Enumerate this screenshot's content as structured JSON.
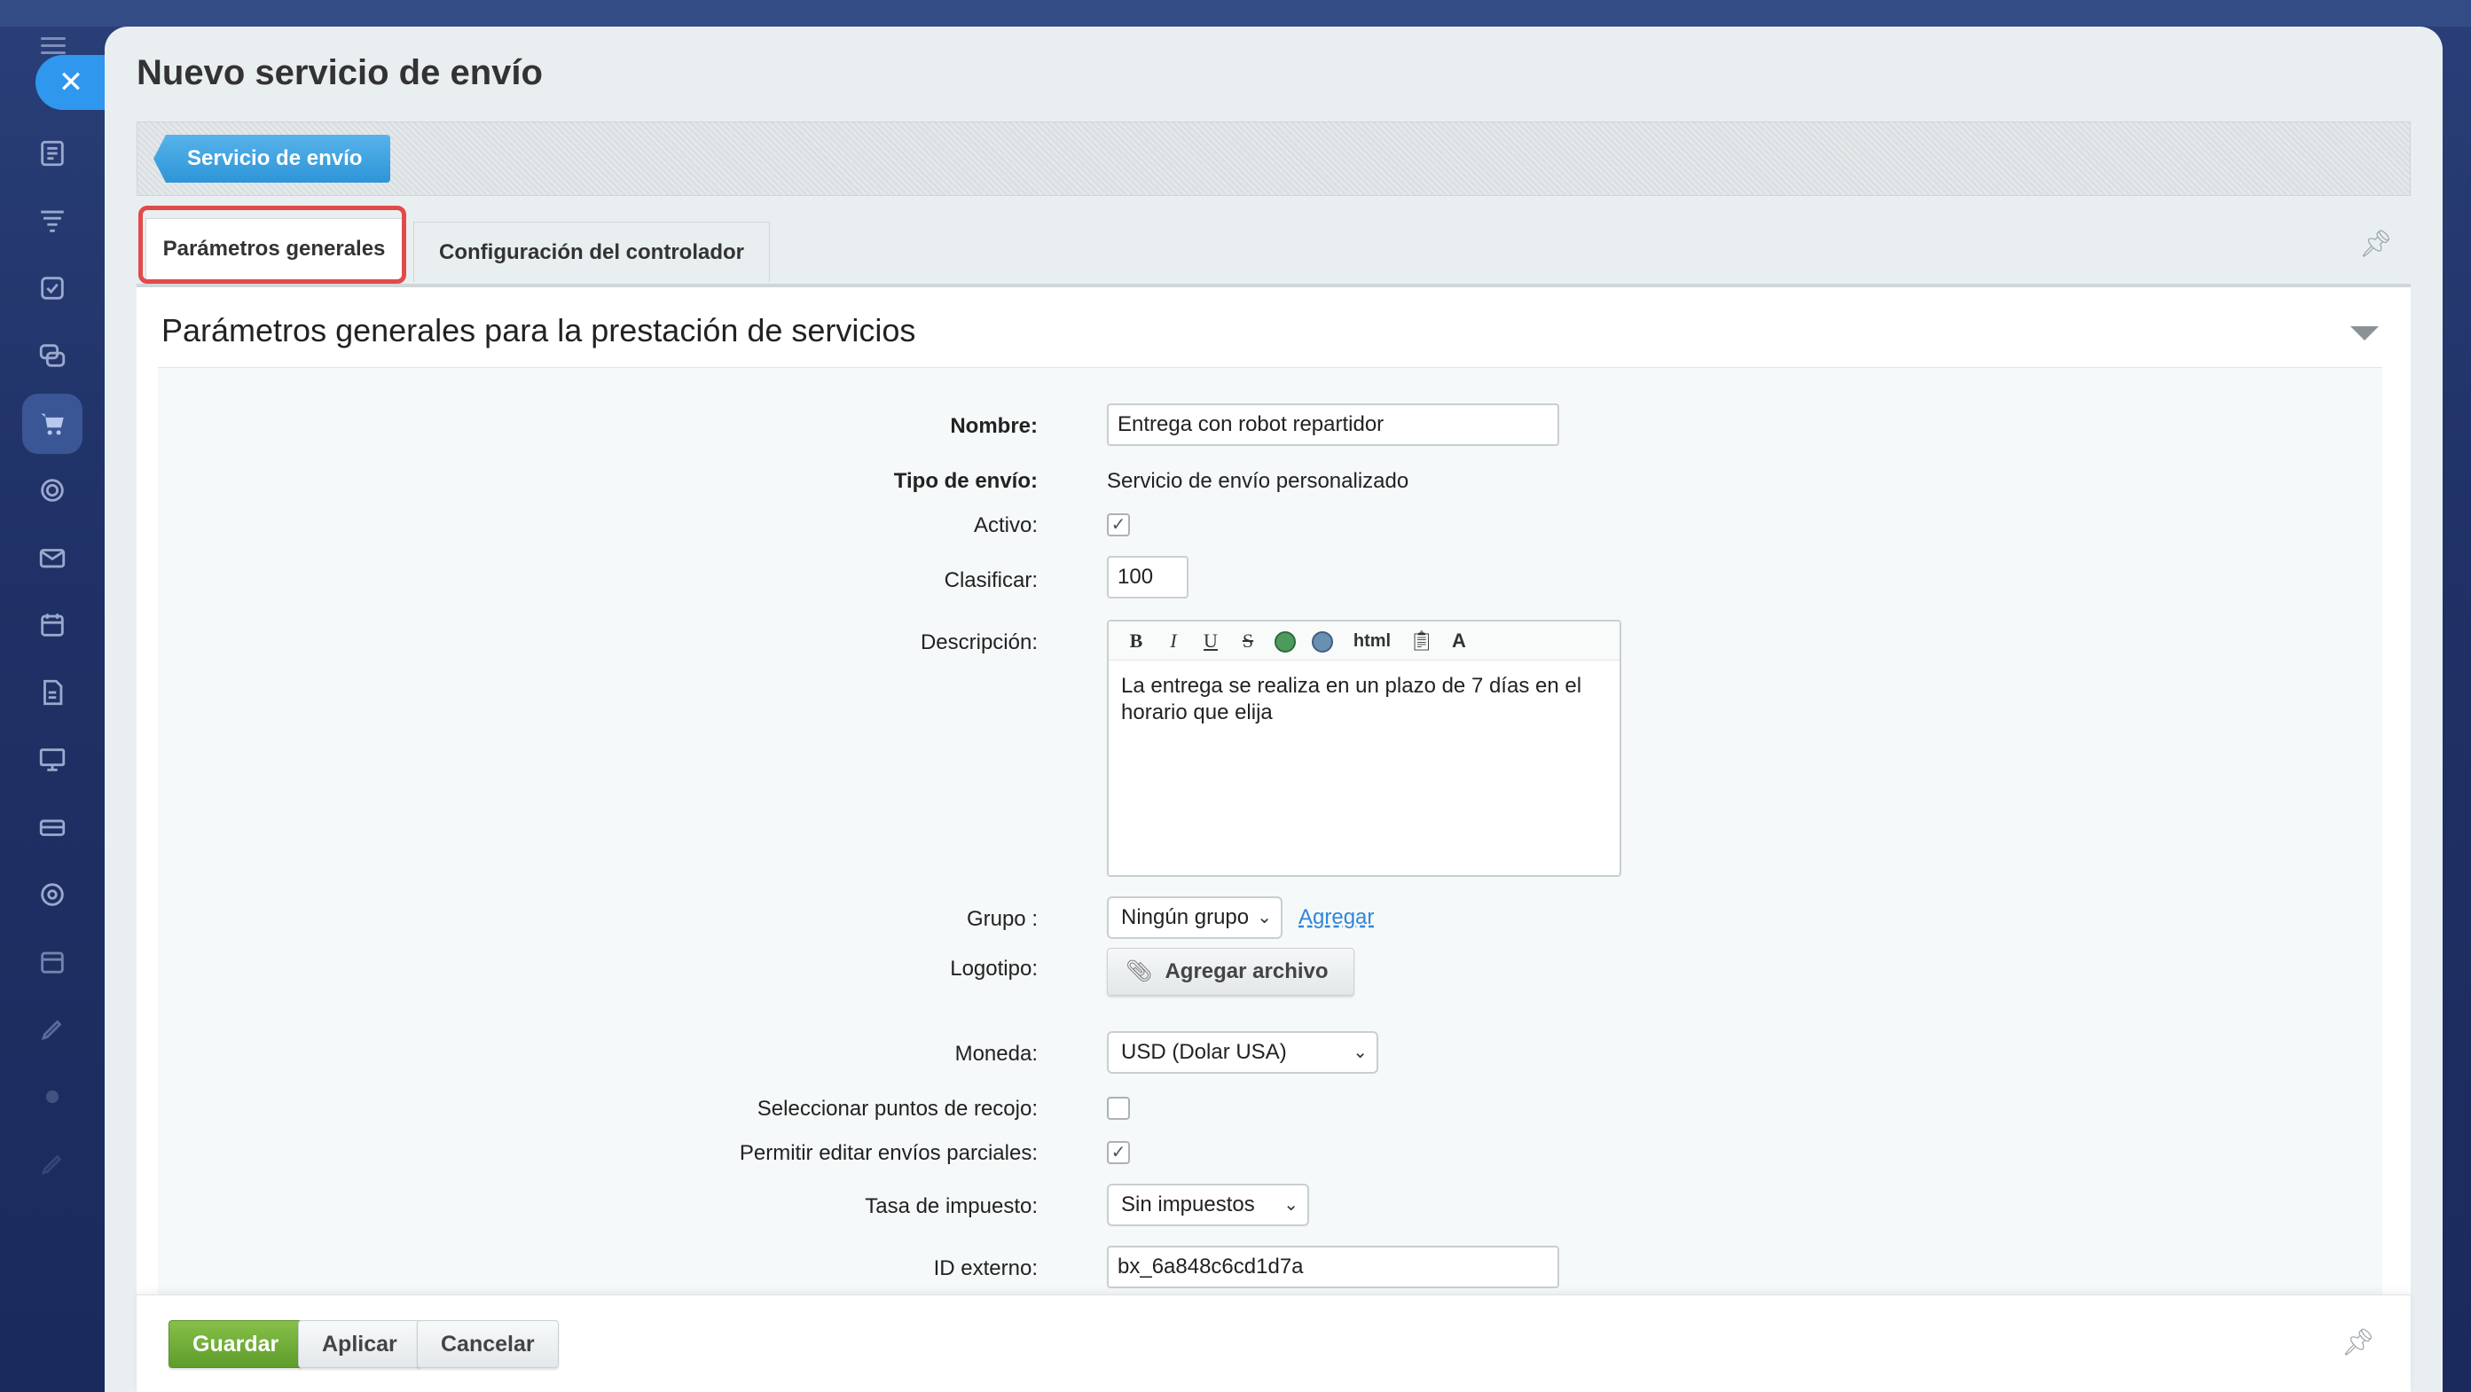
{
  "window": {
    "title": "Nuevo servicio de envío"
  },
  "service_bar": {
    "tag_label": "Servicio de envío"
  },
  "tabs": [
    {
      "label": "Parámetros generales",
      "active": true
    },
    {
      "label": "Configuración del controlador",
      "active": false
    }
  ],
  "section": {
    "title": "Parámetros generales para la prestación de servicios"
  },
  "form": {
    "name": {
      "label": "Nombre:",
      "value": "Entrega con robot repartidor"
    },
    "type": {
      "label": "Tipo de envío:",
      "value": "Servicio de envío personalizado"
    },
    "active": {
      "label": "Activo:",
      "checked": true
    },
    "sort": {
      "label": "Clasificar:",
      "value": "100"
    },
    "description": {
      "label": "Descripción:",
      "toolbar": [
        "B",
        "I",
        "U",
        "S",
        "link-icon",
        "unlink-icon",
        "html",
        "paste-icon",
        "font-icon"
      ],
      "html_label": "html",
      "value": "La entrega se realiza en un plazo de 7 días en el horario que elija"
    },
    "group": {
      "label": "Grupo :",
      "selected": "Ningún grupo",
      "add_link": "Agregar"
    },
    "logo": {
      "label": "Logotipo:",
      "button": "Agregar archivo"
    },
    "currency": {
      "label": "Moneda:",
      "selected": "USD (Dolar USA)"
    },
    "pickup_points": {
      "label": "Seleccionar puntos de recojo:",
      "checked": false
    },
    "partial_edit": {
      "label": "Permitir editar envíos parciales:",
      "checked": true
    },
    "tax_rate": {
      "label": "Tasa de impuesto:",
      "selected": "Sin impuestos"
    },
    "external_id": {
      "label": "ID externo:",
      "value": "bx_6a848c6cd1d7a"
    }
  },
  "footer": {
    "save": "Guardar",
    "apply": "Aplicar",
    "cancel": "Cancelar"
  },
  "colors": {
    "accent_blue": "#2f97ee",
    "primary_green": "#6fae38",
    "highlight_red": "#e24a4a",
    "sidebar_bg": "#1f3166"
  }
}
